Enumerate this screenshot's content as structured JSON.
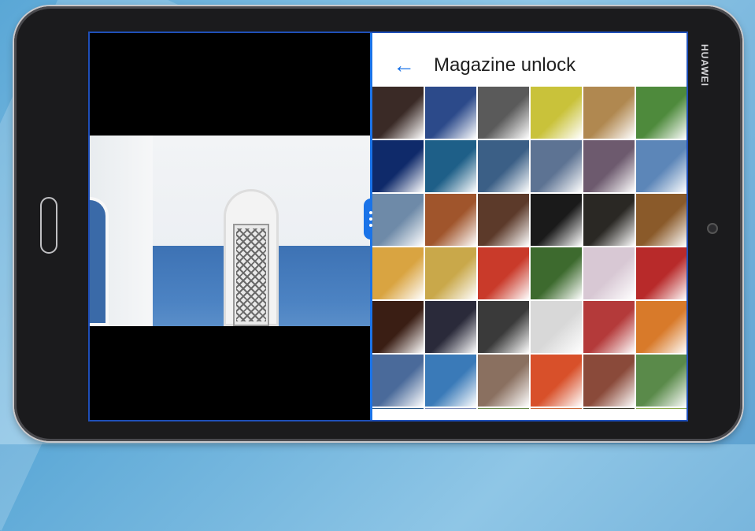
{
  "device": {
    "brand": "HUAWEI"
  },
  "app": {
    "title": "Magazine unlock",
    "back_icon": "arrow-left-icon",
    "accent": "#1a73e8"
  },
  "left_pane": {
    "image": "white wall with arched lattice door and blue shadow"
  },
  "gallery": {
    "rows": [
      [
        "#3a2a26",
        "#2c4a8a",
        "#5a5a5a",
        "#c9c23a",
        "#b08850",
        "#4e8a3c"
      ],
      [
        "#0f2a6a",
        "#1e5f88",
        "#3b5f86",
        "#5d7393",
        "#6d5a6e",
        "#5c86b8"
      ],
      [
        "#6e8aa8",
        "#a0552c",
        "#5c3a2a",
        "#1a1a1a",
        "#2a2824",
        "#8a5a2a"
      ],
      [
        "#d9a441",
        "#c9a84a",
        "#c93a2a",
        "#3d6a2e",
        "#d8c8d4",
        "#b82a2a"
      ],
      [
        "#3a1e14",
        "#2a2a3a",
        "#3a3a3a",
        "#d8d8d8",
        "#b43a3a",
        "#d87a2a"
      ],
      [
        "#4a6a9a",
        "#3a7ab8",
        "#8a7060",
        "#d8502a",
        "#8a4a3a",
        "#5a8a4a"
      ],
      [
        "#2a5a8a",
        "#7a8ab8",
        "#6a8a4a",
        "#c86a3a",
        "#3a3a2a",
        "#8aa84a"
      ]
    ]
  }
}
